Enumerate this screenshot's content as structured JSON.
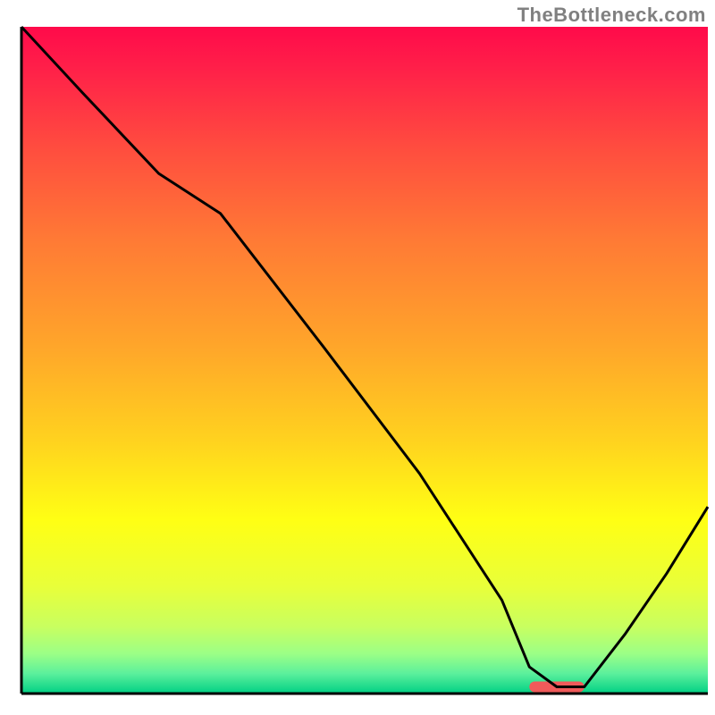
{
  "watermark": "TheBottleneck.com",
  "chart_data": {
    "type": "line",
    "title": "",
    "xlabel": "",
    "ylabel": "",
    "xlim": [
      0,
      100
    ],
    "ylim": [
      0,
      100
    ],
    "grid": false,
    "background": {
      "type": "vertical-gradient",
      "stops": [
        {
          "pos": 0.0,
          "color": "#ff0a4a"
        },
        {
          "pos": 0.06,
          "color": "#ff1f49"
        },
        {
          "pos": 0.18,
          "color": "#ff4c3f"
        },
        {
          "pos": 0.32,
          "color": "#ff7a35"
        },
        {
          "pos": 0.48,
          "color": "#ffa62a"
        },
        {
          "pos": 0.62,
          "color": "#ffd21f"
        },
        {
          "pos": 0.74,
          "color": "#ffff14"
        },
        {
          "pos": 0.84,
          "color": "#e8ff3a"
        },
        {
          "pos": 0.9,
          "color": "#c8ff60"
        },
        {
          "pos": 0.94,
          "color": "#9cff86"
        },
        {
          "pos": 0.97,
          "color": "#5cf09c"
        },
        {
          "pos": 1.0,
          "color": "#00d084"
        }
      ]
    },
    "series": [
      {
        "name": "bottleneck-curve",
        "color": "#000000",
        "x": [
          0,
          9,
          20,
          29,
          44,
          58,
          70,
          74,
          78,
          82,
          88,
          94,
          100
        ],
        "values": [
          100,
          90,
          78,
          72,
          52,
          33,
          14,
          4,
          1,
          1,
          9,
          18,
          28
        ]
      }
    ],
    "markers": [
      {
        "name": "highlight-segment",
        "color": "#f05a5a",
        "x_range": [
          74,
          82
        ],
        "y": 1,
        "thickness_px": 12
      }
    ],
    "axes": {
      "left": {
        "visible": true,
        "color": "#000000",
        "thickness_px": 3
      },
      "bottom": {
        "visible": true,
        "color": "#000000",
        "thickness_px": 3
      },
      "right": {
        "visible": false
      },
      "top": {
        "visible": false
      }
    }
  }
}
